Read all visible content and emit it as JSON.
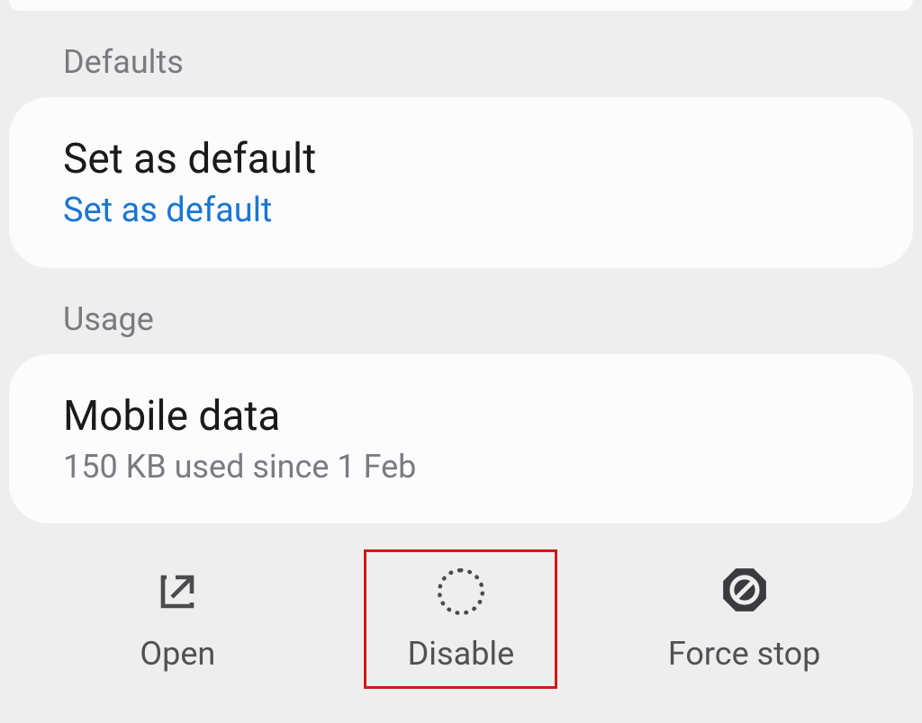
{
  "sections": {
    "defaults": {
      "label": "Defaults",
      "item": {
        "title": "Set as default",
        "subtitle": "Set as default"
      }
    },
    "usage": {
      "label": "Usage",
      "item": {
        "title": "Mobile data",
        "subtitle": "150 KB used since 1 Feb"
      }
    }
  },
  "bottom_bar": {
    "open": "Open",
    "disable": "Disable",
    "force_stop": "Force stop"
  }
}
